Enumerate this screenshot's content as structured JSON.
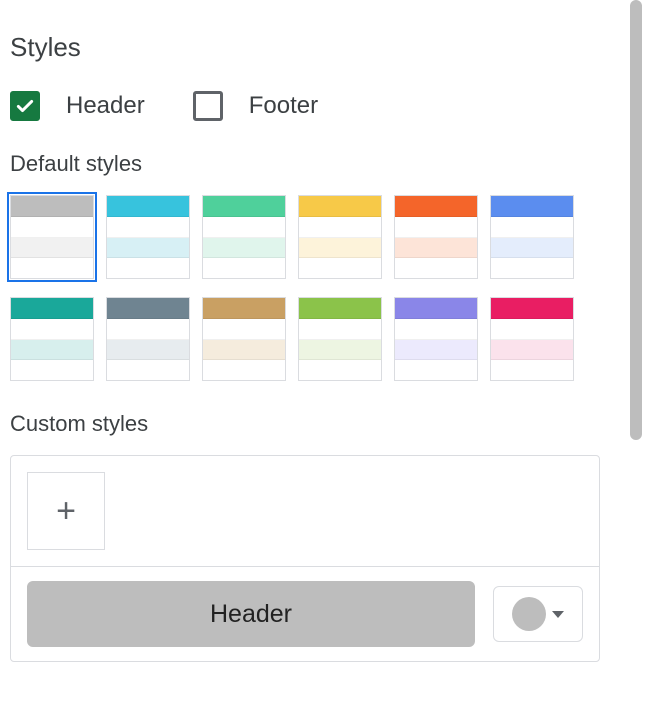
{
  "sections": {
    "styles_title": "Styles",
    "default_styles_title": "Default styles",
    "custom_styles_title": "Custom styles"
  },
  "checkboxes": {
    "header": {
      "label": "Header",
      "checked": true
    },
    "footer": {
      "label": "Footer",
      "checked": false
    }
  },
  "default_styles": [
    {
      "id": "grey",
      "selected": true,
      "bands": [
        "#bdbdbd",
        "#ffffff",
        "#f1f1f1",
        "#ffffff"
      ]
    },
    {
      "id": "cyan",
      "selected": false,
      "bands": [
        "#37c3dd",
        "#ffffff",
        "#d7f0f5",
        "#ffffff"
      ]
    },
    {
      "id": "green",
      "selected": false,
      "bands": [
        "#4fd09b",
        "#ffffff",
        "#e0f5ec",
        "#ffffff"
      ]
    },
    {
      "id": "yellow",
      "selected": false,
      "bands": [
        "#f7c948",
        "#ffffff",
        "#fdf3da",
        "#ffffff"
      ]
    },
    {
      "id": "orange",
      "selected": false,
      "bands": [
        "#f4652a",
        "#ffffff",
        "#fde4d8",
        "#ffffff"
      ]
    },
    {
      "id": "blue",
      "selected": false,
      "bands": [
        "#5b8def",
        "#ffffff",
        "#e4edfc",
        "#ffffff"
      ]
    },
    {
      "id": "teal",
      "selected": false,
      "bands": [
        "#1aa89a",
        "#ffffff",
        "#d7efed",
        "#ffffff"
      ]
    },
    {
      "id": "slate",
      "selected": false,
      "bands": [
        "#6f8491",
        "#ffffff",
        "#e7ecef",
        "#ffffff"
      ]
    },
    {
      "id": "tan",
      "selected": false,
      "bands": [
        "#c9a063",
        "#ffffff",
        "#f5ecdd",
        "#ffffff"
      ]
    },
    {
      "id": "lime",
      "selected": false,
      "bands": [
        "#8bc34a",
        "#ffffff",
        "#edf5e2",
        "#ffffff"
      ]
    },
    {
      "id": "purple",
      "selected": false,
      "bands": [
        "#8a86e8",
        "#ffffff",
        "#eceafd",
        "#ffffff"
      ]
    },
    {
      "id": "pink",
      "selected": false,
      "bands": [
        "#e91e63",
        "#ffffff",
        "#fbe2ec",
        "#ffffff"
      ]
    }
  ],
  "custom": {
    "add_label": "+",
    "header_chip_label": "Header",
    "picker_color": "#bdbdbd"
  }
}
